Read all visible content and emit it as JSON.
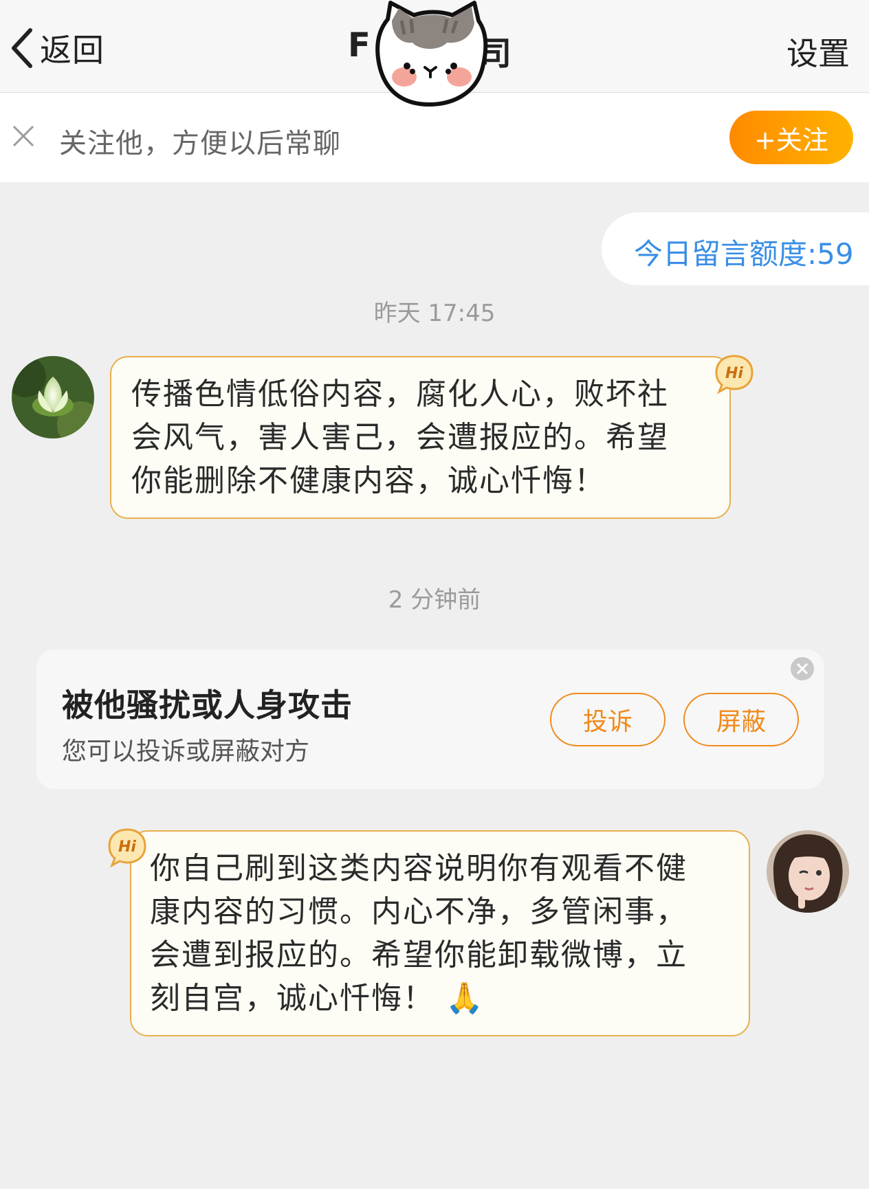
{
  "header": {
    "back_label": "返回",
    "title_left": "F",
    "title_right": "司",
    "settings_label": "设置"
  },
  "follow_bar": {
    "text": "关注他，方便以后常聊",
    "button_label": "+关注"
  },
  "quota": {
    "text": "今日留言额度:59"
  },
  "messages": [
    {
      "timestamp": "昨天 17:45",
      "side": "left",
      "badge": "Hi",
      "lines": [
        "传播色情低俗内容，腐化人心，败坏社",
        "会风气，害人害己，会遭报应的。希望",
        "你能删除不健康内容，诚心忏悔！"
      ]
    },
    {
      "timestamp": "2 分钟前",
      "side": "right",
      "badge": "Hi",
      "lines": [
        "你自己刷到这类内容说明你有观看不健",
        "康内容的习惯。内心不净，多管闲事，",
        "会遭到报应的。希望你能卸载微博，立",
        "刻自宫，诚心忏悔！"
      ],
      "emoji": "🙏"
    }
  ],
  "harassment_card": {
    "title": "被他骚扰或人身攻击",
    "subtitle": "您可以投诉或屏蔽对方",
    "report_label": "投诉",
    "block_label": "屏蔽"
  },
  "colors": {
    "accent_orange": "#f08a1c",
    "quota_blue": "#3a8ee6",
    "bubble_border": "#e8b04a",
    "background": "#efefef"
  },
  "icons": [
    "chevron-left-icon",
    "cat-sticker",
    "close-icon",
    "hi-badge-icon",
    "lotus-avatar",
    "user-avatar",
    "close-circle-icon"
  ]
}
